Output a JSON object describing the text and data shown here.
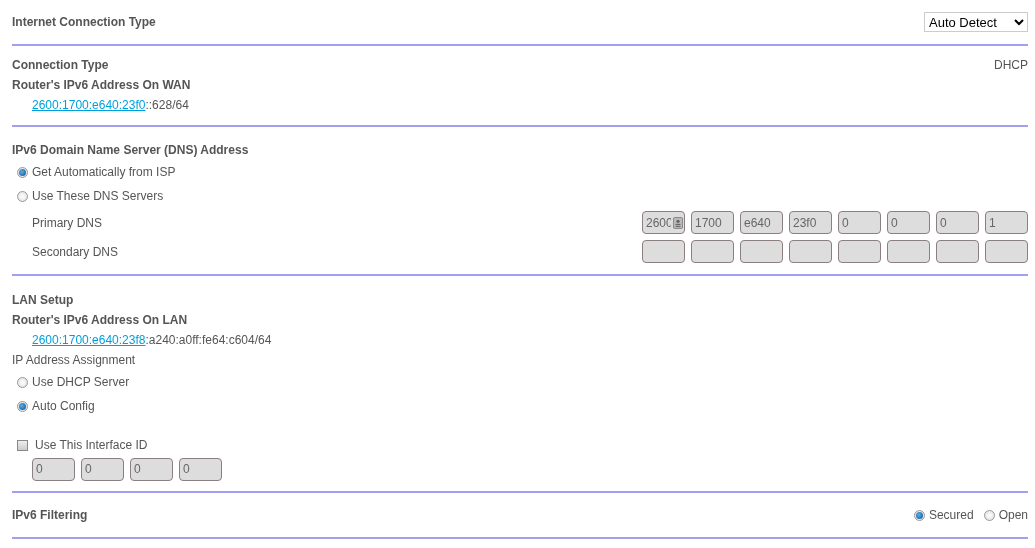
{
  "connection": {
    "title": "Internet Connection Type",
    "select": "Auto Detect"
  },
  "wan": {
    "type_label": "Connection Type",
    "type_value": "DHCP",
    "address_label": "Router's IPv6 Address On WAN",
    "address_link": "2600:1700:e640:23f0",
    "address_rest": "::628/64"
  },
  "dns": {
    "title": "IPv6 Domain Name Server (DNS) Address",
    "options": [
      {
        "label": "Get Automatically from ISP",
        "selected": true
      },
      {
        "label": "Use These DNS Servers",
        "selected": false
      }
    ],
    "servers": [
      {
        "label": "Primary DNS",
        "values": [
          "2600",
          "1700",
          "e640",
          "23f0",
          "0",
          "0",
          "0",
          "1"
        ],
        "autofill": true
      },
      {
        "label": "Secondary DNS"
      }
    ]
  },
  "lan": {
    "title": "LAN Setup",
    "address_label": "Router's IPv6 Address On LAN",
    "address_link": "2600:1700:e640:23f8",
    "address_rest": ":a240:a0ff:fe64:c604/64",
    "assignment_label": "IP Address Assignment",
    "options": [
      {
        "label": "Use DHCP Server",
        "selected": false
      },
      {
        "label": "Auto Config",
        "selected": true
      }
    ],
    "interface_id": {
      "label": "Use This Interface ID",
      "checked": false,
      "values": [
        "0",
        "0",
        "0",
        "0"
      ]
    }
  },
  "filtering": {
    "title": "IPv6 Filtering",
    "options": [
      {
        "label": "Secured",
        "selected": true
      },
      {
        "label": "Open",
        "selected": false
      }
    ]
  }
}
